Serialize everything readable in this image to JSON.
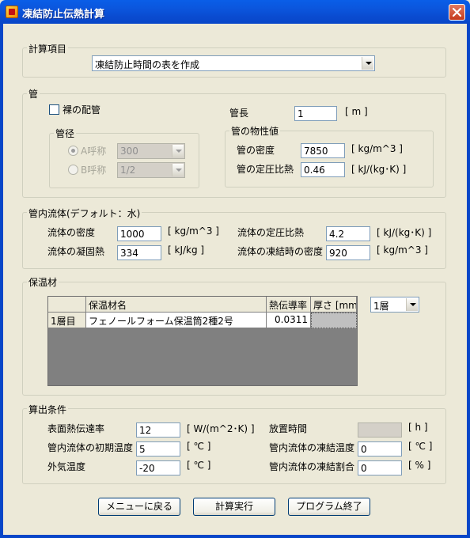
{
  "window": {
    "title": "凍結防止伝熱計算"
  },
  "calc_item": {
    "legend": "計算項目",
    "selected": "凍結防止時間の表を作成"
  },
  "pipe": {
    "legend": "管",
    "bare_label": "裸の配管",
    "bare_checked": false,
    "length_label": "管長",
    "length_value": "1",
    "length_unit": "[ m ]",
    "diameter": {
      "legend": "管径",
      "a_label": "A呼称",
      "a_value": "300",
      "b_label": "B呼称",
      "b_value": "1/2"
    },
    "properties": {
      "legend": "管の物性値",
      "density_label": "管の密度",
      "density_value": "7850",
      "density_unit": "[ kg/m^3 ]",
      "cp_label": "管の定圧比熱",
      "cp_value": "0.46",
      "cp_unit": "[ kJ/(kg･K) ]"
    }
  },
  "fluid": {
    "legend": "管内流体(デフォルト：水)",
    "density_label": "流体の密度",
    "density_value": "1000",
    "density_unit": "[ kg/m^3 ]",
    "cp_label": "流体の定圧比熱",
    "cp_value": "4.2",
    "cp_unit": "[ kJ/(kg･K) ]",
    "latent_label": "流体の凝固熱",
    "latent_value": "334",
    "latent_unit": "[ kJ/kg ]",
    "frozen_density_label": "流体の凍結時の密度",
    "frozen_density_value": "920",
    "frozen_density_unit": "[ kg/m^3 ]"
  },
  "insulation": {
    "legend": "保温材",
    "columns": [
      "",
      "保温材名",
      "熱伝導率",
      "厚さ [mm]"
    ],
    "rows": [
      {
        "layer": "1層目",
        "name": "フェノールフォーム保温筒2種2号",
        "conductivity": "0.0311",
        "thickness": ""
      }
    ],
    "layer_select": "1層"
  },
  "conditions": {
    "legend": "算出条件",
    "surface_label": "表面熱伝達率",
    "surface_value": "12",
    "surface_unit": "[ W/(m^2･K) ]",
    "time_label": "放置時間",
    "time_value": "",
    "time_unit": "[ h ]",
    "initial_label": "管内流体の初期温度",
    "initial_value": "5",
    "initial_unit": "[ ℃ ]",
    "freeze_temp_label": "管内流体の凍結温度",
    "freeze_temp_value": "0",
    "freeze_temp_unit": "[ ℃ ]",
    "outside_label": "外気温度",
    "outside_value": "-20",
    "outside_unit": "[ ℃ ]",
    "freeze_ratio_label": "管内流体の凍結割合",
    "freeze_ratio_value": "0",
    "freeze_ratio_unit": "[ % ]"
  },
  "buttons": {
    "menu": "メニューに戻る",
    "run": "計算実行",
    "exit": "プログラム終了"
  },
  "colors": {
    "titlebar": "#0a4bd0",
    "face": "#ece9d8",
    "grid_bg": "#808080"
  }
}
